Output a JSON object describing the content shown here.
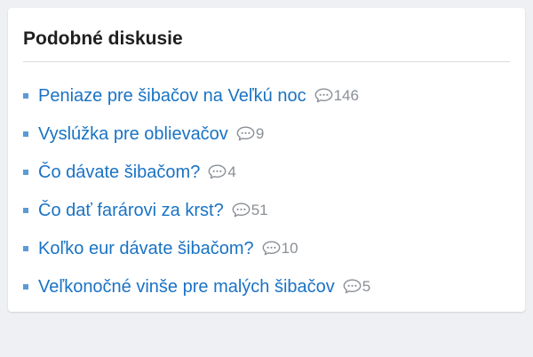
{
  "widget": {
    "title": "Podobné diskusie",
    "comment_icon": "speech-bubble-icon",
    "colors": {
      "link": "#1a73c4",
      "bullet": "#5a9bd6",
      "count": "#8a8f96",
      "title": "#1f1f1f"
    },
    "items": [
      {
        "label": "Peniaze pre šibačov na Veľkú noc",
        "count": "146"
      },
      {
        "label": "Vyslúžka pre oblievačov",
        "count": "9"
      },
      {
        "label": "Čo dávate šibačom?",
        "count": "4"
      },
      {
        "label": "Čo dať farárovi za krst?",
        "count": "51"
      },
      {
        "label": "Koľko eur dávate šibačom?",
        "count": "10"
      },
      {
        "label": "Veľkonočné vinše pre malých šibačov",
        "count": "5"
      }
    ]
  }
}
